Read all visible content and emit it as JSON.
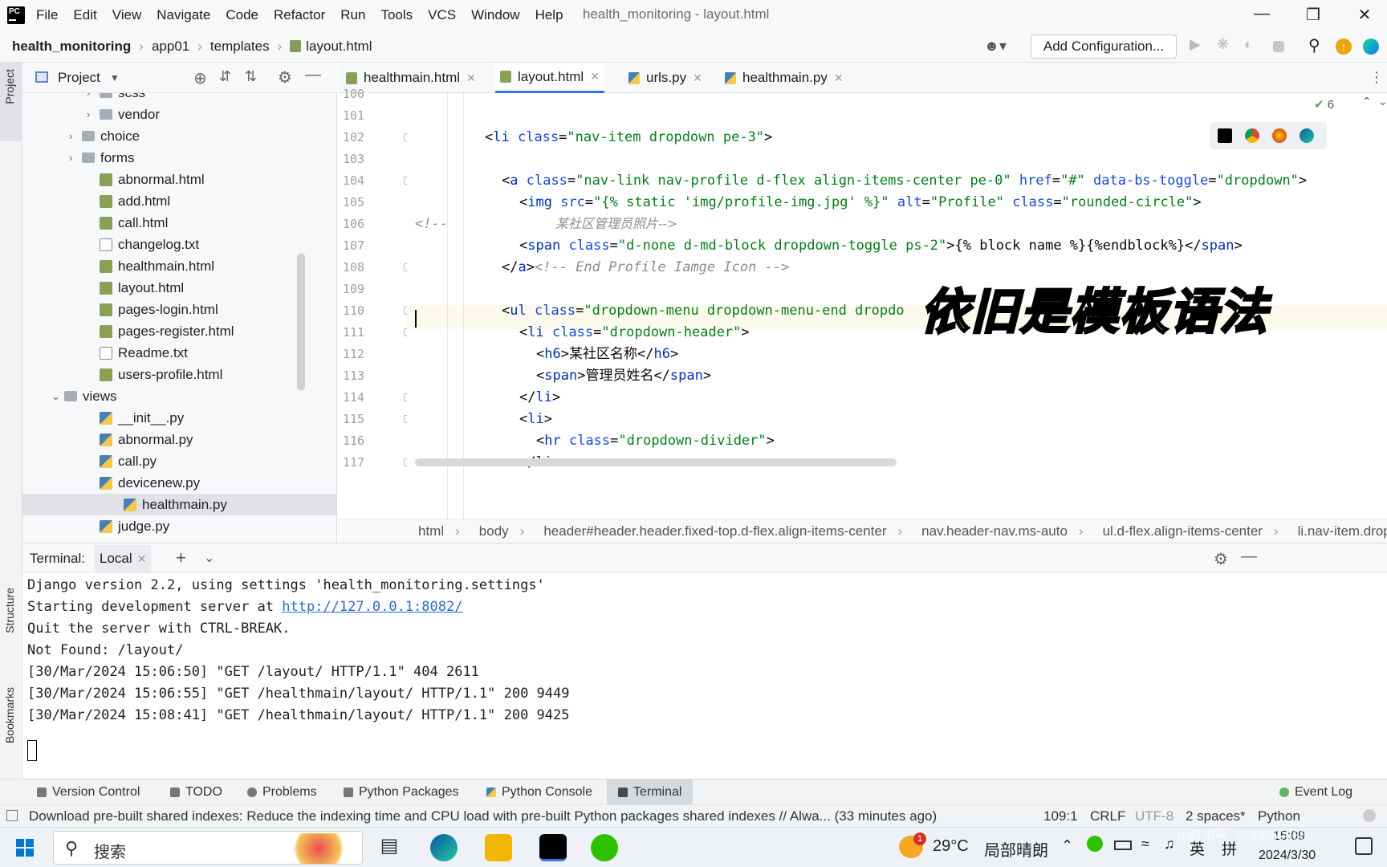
{
  "menubar": {
    "items": [
      "File",
      "Edit",
      "View",
      "Navigate",
      "Code",
      "Refactor",
      "Run",
      "Tools",
      "VCS",
      "Window",
      "Help"
    ],
    "title": "health_monitoring - layout.html"
  },
  "navbar": {
    "crumbs": [
      "health_monitoring",
      "app01",
      "templates",
      "layout.html"
    ],
    "config_label": "Add Configuration..."
  },
  "side_labels": {
    "project": "Project",
    "structure": "Structure",
    "bookmarks": "Bookmarks"
  },
  "project_panel": {
    "title": "Project"
  },
  "tree": [
    {
      "label": "scss",
      "type": "folder"
    },
    {
      "label": "vendor",
      "type": "folder"
    },
    {
      "label": "choice",
      "type": "folder"
    },
    {
      "label": "forms",
      "type": "folder"
    },
    {
      "label": "abnormal.html",
      "type": "html"
    },
    {
      "label": "add.html",
      "type": "html"
    },
    {
      "label": "call.html",
      "type": "html"
    },
    {
      "label": "changelog.txt",
      "type": "txt"
    },
    {
      "label": "healthmain.html",
      "type": "html"
    },
    {
      "label": "layout.html",
      "type": "html"
    },
    {
      "label": "pages-login.html",
      "type": "html"
    },
    {
      "label": "pages-register.html",
      "type": "html"
    },
    {
      "label": "Readme.txt",
      "type": "txt"
    },
    {
      "label": "users-profile.html",
      "type": "html"
    },
    {
      "label": "views",
      "type": "folder"
    },
    {
      "label": "__init__.py",
      "type": "py"
    },
    {
      "label": "abnormal.py",
      "type": "py"
    },
    {
      "label": "call.py",
      "type": "py"
    },
    {
      "label": "devicenew.py",
      "type": "py"
    },
    {
      "label": "healthmain.py",
      "type": "py"
    },
    {
      "label": "judge.py",
      "type": "py"
    }
  ],
  "tabs": [
    {
      "label": "healthmain.html"
    },
    {
      "label": "layout.html"
    },
    {
      "label": "urls.py"
    },
    {
      "label": "healthmain.py"
    }
  ],
  "editor": {
    "inspection_count": "6",
    "line_numbers": [
      "100",
      "101",
      "102",
      "103",
      "104",
      "105",
      "106",
      "107",
      "108",
      "109",
      "110",
      "111",
      "112",
      "113",
      "114",
      "115",
      "116",
      "117"
    ],
    "lines": {
      "l102": [
        "<",
        "li",
        " class",
        "=",
        "\"nav-item dropdown pe-3\"",
        ">"
      ],
      "l104": [
        "<",
        "a",
        " class",
        "=",
        "\"nav-link nav-profile d-flex align-items-center pe-0\"",
        " href",
        "=",
        "\"#\"",
        " data-bs-toggle",
        "=",
        "\"dropdown\"",
        ">"
      ],
      "l105": [
        "<",
        "img",
        " src",
        "=",
        "\"{% static 'img/profile-img.jpg' %}\"",
        " alt",
        "=",
        "\"Profile\"",
        " class",
        "=",
        "\"rounded-circle\"",
        ">"
      ],
      "l106a": "<!--",
      "l106b": "某社区管理员照片-->",
      "l107": [
        "<",
        "span",
        " class",
        "=",
        "\"d-none d-md-block dropdown-toggle ps-2\"",
        ">{% block name %}{%endblock%}</",
        "span",
        ">"
      ],
      "l108": [
        "</",
        "a",
        ">",
        "<!-- End Profile Iamge Icon -->"
      ],
      "l110": [
        "<",
        "ul",
        " class",
        "=",
        "\"dropdown-menu dropdown-menu-end dropdo"
      ],
      "l111": [
        "<",
        "li",
        " class",
        "=",
        "\"dropdown-header\"",
        ">"
      ],
      "l112": [
        "<",
        "h6",
        ">某社区名称</",
        "h6",
        ">"
      ],
      "l113": [
        "<",
        "span",
        ">管理员姓名</",
        "span",
        ">"
      ],
      "l114": [
        "</",
        "li",
        ">"
      ],
      "l115": [
        "<",
        "li",
        ">"
      ],
      "l116": [
        "<",
        "hr",
        " class",
        "=",
        "\"dropdown-divider\"",
        ">"
      ],
      "l117": [
        "</",
        "li",
        ">"
      ]
    },
    "overlay_caption": "依旧是模板语法"
  },
  "breadcrumb": [
    "html",
    "body",
    "header#header.header.fixed-top.d-flex.align-items-center",
    "nav.header-nav.ms-auto",
    "ul.d-flex.align-items-center",
    "li.nav-item.dropd"
  ],
  "terminal": {
    "label": "Terminal:",
    "tab": "Local",
    "lines": [
      "Django version 2.2, using settings 'health_monitoring.settings'",
      "Quit the server with CTRL-BREAK.",
      "Not Found: /layout/",
      "[30/Mar/2024 15:06:50] \"GET /layout/ HTTP/1.1\" 404 2611",
      "[30/Mar/2024 15:06:55] \"GET /healthmain/layout/ HTTP/1.1\" 200 9449",
      "[30/Mar/2024 15:08:41] \"GET /healthmain/layout/ HTTP/1.1\" 200 9425"
    ],
    "server_prefix": "Starting development server at ",
    "server_url": "http://127.0.0.1:8082/"
  },
  "tool_windows": [
    "Version Control",
    "TODO",
    "Problems",
    "Python Packages",
    "Python Console",
    "Terminal",
    "Event Log"
  ],
  "status": {
    "message": "Download pre-built shared indexes: Reduce the indexing time and CPU load with pre-built Python packages shared indexes // Alwa... (33 minutes ago)",
    "position": "109:1",
    "line_sep": "CRLF",
    "encoding": "UTF-8",
    "indent": "2 spaces*",
    "interpreter": "Python"
  },
  "taskbar": {
    "search": "搜索",
    "weather_temp": "29°C",
    "weather_text": "局部晴朗",
    "ime1": "英",
    "ime2": "拼",
    "time": "15:09",
    "date": "2024/3/30",
    "notif_badge": "1",
    "watermark": "小红书号: 2633959038"
  }
}
